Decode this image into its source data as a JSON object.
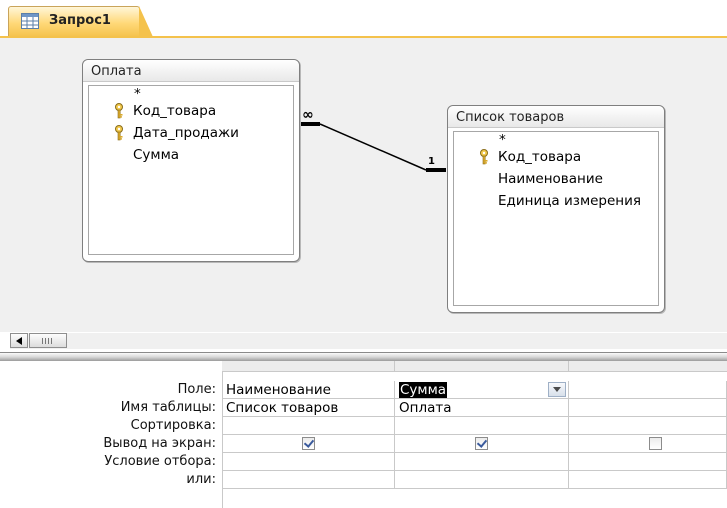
{
  "tab": {
    "title": "Запрос1",
    "icon": "query-icon"
  },
  "tables": [
    {
      "title": "Оплата",
      "fields": [
        {
          "name": "*",
          "key": false
        },
        {
          "name": "Код_товара",
          "key": true
        },
        {
          "name": "Дата_продажи",
          "key": true
        },
        {
          "name": "Сумма",
          "key": false
        }
      ]
    },
    {
      "title": "Список товаров",
      "fields": [
        {
          "name": "*",
          "key": false
        },
        {
          "name": "Код_товара",
          "key": true
        },
        {
          "name": "Наименование",
          "key": false
        },
        {
          "name": "Единица измерения",
          "key": false
        }
      ]
    }
  ],
  "relationship": {
    "many_label": "∞",
    "one_label": "1"
  },
  "grid": {
    "row_labels": [
      "Поле:",
      "Имя таблицы:",
      "Сортировка:",
      "Вывод на экран:",
      "Условие отбора:",
      "или:"
    ],
    "columns": [
      {
        "field": "Наименование",
        "table": "Список товаров",
        "sort": "",
        "show": true,
        "criteria": "",
        "or": ""
      },
      {
        "field": "Сумма",
        "table": "Оплата",
        "sort": "",
        "show": true,
        "criteria": "",
        "or": "",
        "selected": true
      },
      {
        "field": "",
        "table": "",
        "sort": "",
        "show": false,
        "criteria": "",
        "or": ""
      }
    ]
  }
}
